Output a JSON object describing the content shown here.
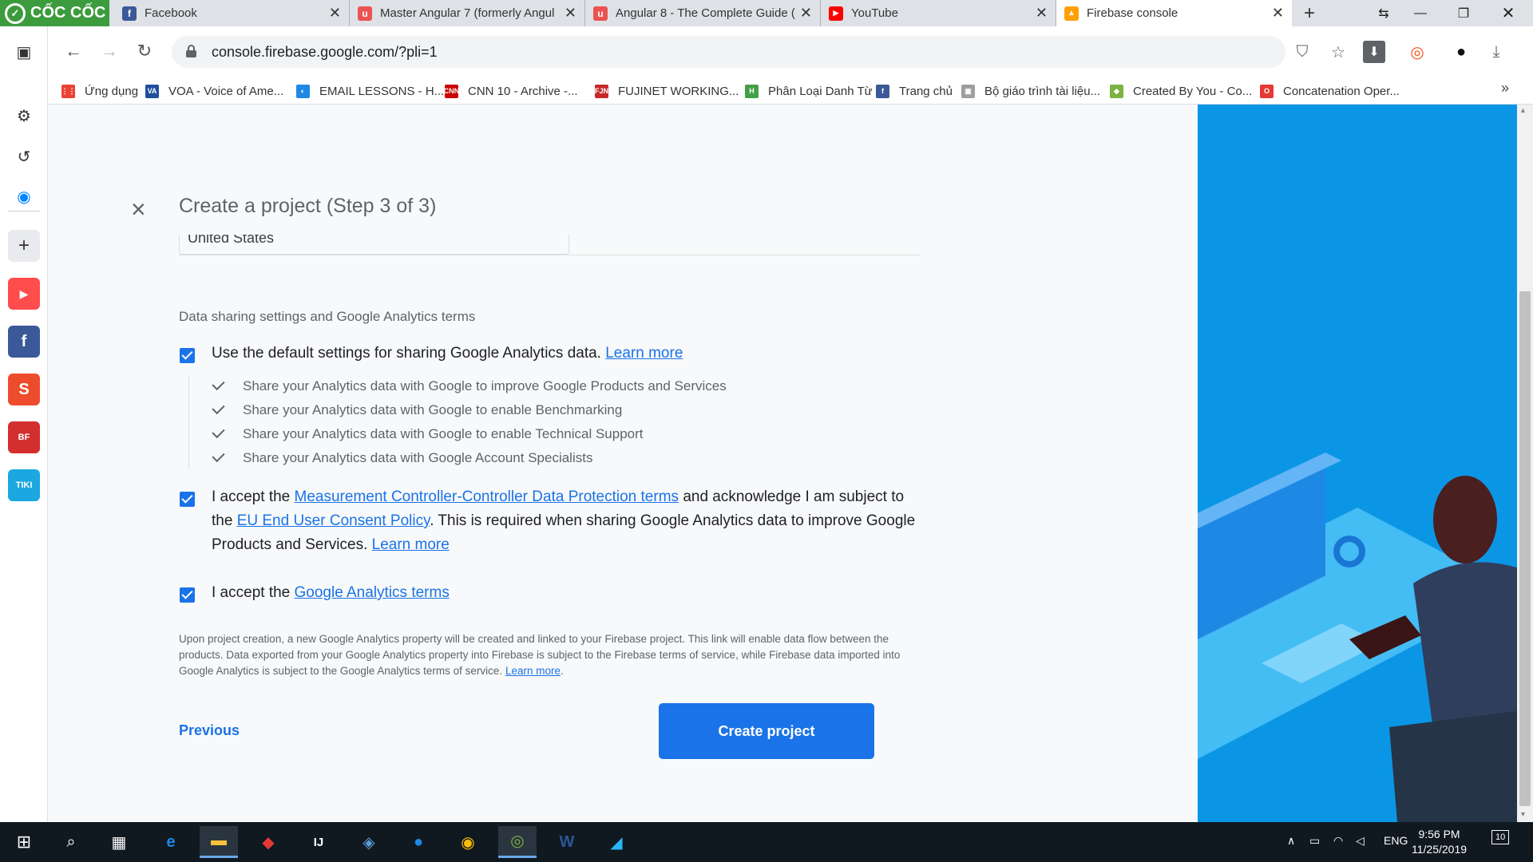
{
  "browser": {
    "brand": "CỐC CỐC",
    "tabs": [
      {
        "title": "Facebook",
        "icon": "facebook-icon",
        "icon_color": "#3b5998",
        "glyph": "f",
        "active": false
      },
      {
        "title": "Master Angular 7 (formerly Angul",
        "icon": "udemy-icon",
        "icon_color": "#ec5252",
        "glyph": "u",
        "active": false
      },
      {
        "title": "Angular 8 - The Complete Guide (",
        "icon": "udemy-icon",
        "icon_color": "#ec5252",
        "glyph": "u",
        "active": false
      },
      {
        "title": "YouTube",
        "icon": "youtube-icon",
        "icon_color": "#ff0000",
        "glyph": "▶",
        "active": false
      },
      {
        "title": "Firebase console",
        "icon": "firebase-icon",
        "icon_color": "#ffa000",
        "glyph": "▲",
        "active": true
      }
    ],
    "url": "console.firebase.google.com/?pli=1",
    "bookmarks": [
      {
        "label": "Ứng dụng",
        "icon": "apps-grid-icon",
        "color": "#ea4335",
        "glyph": "⋮⋮"
      },
      {
        "label": "VOA - Voice of Ame...",
        "icon": "voa-icon",
        "color": "#1f4e9c",
        "glyph": "VA"
      },
      {
        "label": "EMAIL LESSONS - H...",
        "icon": "email-lessons-icon",
        "color": "#1e88e5",
        "glyph": "◐"
      },
      {
        "label": "CNN 10 - Archive -...",
        "icon": "cnn-icon",
        "color": "#cc0000",
        "glyph": "CNN"
      },
      {
        "label": "FUJINET WORKING...",
        "icon": "fujinet-icon",
        "color": "#c62828",
        "glyph": "FJN"
      },
      {
        "label": "Phân Loại Danh Từ",
        "icon": "h-icon",
        "color": "#43a047",
        "glyph": "H"
      },
      {
        "label": "Trang chủ",
        "icon": "facebook-icon",
        "color": "#3b5998",
        "glyph": "f"
      },
      {
        "label": "Bộ giáo trình tài liệu...",
        "icon": "book-icon",
        "color": "#9e9e9e",
        "glyph": "▣"
      },
      {
        "label": "Created By You - Co...",
        "icon": "codewars-icon",
        "color": "#7cb342",
        "glyph": "◆"
      },
      {
        "label": "Concatenation Oper...",
        "icon": "oracle-icon",
        "color": "#e53935",
        "glyph": "O"
      }
    ]
  },
  "dialog": {
    "title": "Create a project (Step 3 of 3)",
    "country_value": "United States",
    "section_heading": "Data sharing settings and Google Analytics terms",
    "option1": {
      "text": "Use the default settings for sharing Google Analytics data.",
      "link": "Learn more",
      "checked": true
    },
    "sub_items": [
      "Share your Analytics data with Google to improve Google Products and Services",
      "Share your Analytics data with Google to enable Benchmarking",
      "Share your Analytics data with Google to enable Technical Support",
      "Share your Analytics data with Google Account Specialists"
    ],
    "option2": {
      "text_a": "I accept the",
      "link_a": "Measurement Controller-Controller Data Protection terms",
      "text_b": "and acknowledge I am subject to the",
      "link_b": "EU End User Consent Policy",
      "text_c": ". This is required when sharing Google Analytics data to improve Google Products and Services.",
      "link_c": "Learn more",
      "checked": true
    },
    "option3": {
      "text": "I accept the",
      "link": "Google Analytics terms",
      "checked": true
    },
    "fine_print": "Upon project creation, a new Google Analytics property will be created and linked to your Firebase project. This link will enable data flow between the products. Data exported from your Google Analytics property into Firebase is subject to the Firebase terms of service, while Firebase data imported into Google Analytics is subject to the Google Analytics terms of service.",
    "fine_link": "Learn more",
    "previous_label": "Previous",
    "create_label": "Create project"
  },
  "taskbar": {
    "language": "ENG",
    "time": "9:56 PM",
    "date": "11/25/2019",
    "notifications": "10"
  },
  "colors": {
    "accent": "#1a73e8",
    "illustration_bg": "#0b96e5",
    "brand_green": "#3c9b3c"
  }
}
